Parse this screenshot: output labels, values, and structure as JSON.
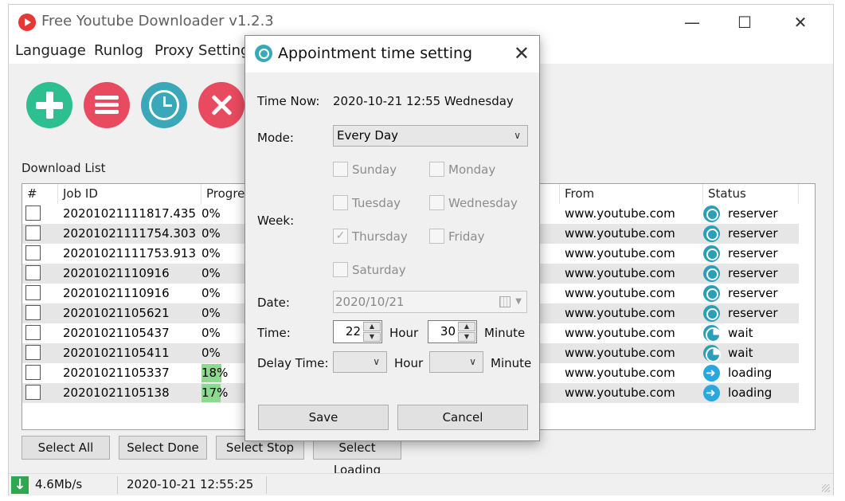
{
  "app": {
    "title": "Free Youtube Downloader v1.2.3",
    "minimize": "—",
    "maximize": "☐",
    "close": "✕"
  },
  "menu": [
    "Language",
    "Runlog",
    "Proxy Setting"
  ],
  "download_list_label": "Download List",
  "table": {
    "columns": [
      "#",
      "Job ID",
      "Progress",
      "From",
      "Status"
    ],
    "rows": [
      {
        "job_id": "20201021111817.435",
        "progress": "0%",
        "progress_value": 0,
        "from": "www.youtube.com",
        "status": "reserver"
      },
      {
        "job_id": "20201021111754.303",
        "progress": "0%",
        "progress_value": 0,
        "from": "www.youtube.com",
        "status": "reserver"
      },
      {
        "job_id": "20201021111753.913",
        "progress": "0%",
        "progress_value": 0,
        "from": "www.youtube.com",
        "status": "reserver"
      },
      {
        "job_id": "20201021110916",
        "progress": "0%",
        "progress_value": 0,
        "from": "www.youtube.com",
        "status": "reserver"
      },
      {
        "job_id": "20201021110916",
        "progress": "0%",
        "progress_value": 0,
        "from": "www.youtube.com",
        "status": "reserver"
      },
      {
        "job_id": "20201021105621",
        "progress": "0%",
        "progress_value": 0,
        "from": "www.youtube.com",
        "status": "reserver"
      },
      {
        "job_id": "20201021105437",
        "progress": "0%",
        "progress_value": 0,
        "from": "www.youtube.com",
        "status": "wait"
      },
      {
        "job_id": "20201021105411",
        "progress": "0%",
        "progress_value": 0,
        "from": "www.youtube.com",
        "status": "wait"
      },
      {
        "job_id": "20201021105337",
        "progress": "18%",
        "progress_value": 18,
        "from": "www.youtube.com",
        "status": "loading"
      },
      {
        "job_id": "20201021105138",
        "progress": "17%",
        "progress_value": 17,
        "from": "www.youtube.com",
        "status": "loading"
      }
    ]
  },
  "buttons": {
    "select_all": "Select All",
    "select_done": "Select Done",
    "select_stop": "Select Stop",
    "select_loading": "Select Loading"
  },
  "statusbar": {
    "speed": "4.6Mb/s",
    "datetime": "2020-10-21 12:55:25"
  },
  "dialog": {
    "title": "Appointment time setting",
    "time_now_label": "Time Now:",
    "time_now_value": "2020-10-21 12:55 Wednesday",
    "mode_label": "Mode:",
    "mode_value": "Every Day",
    "week_label": "Week:",
    "weekdays": [
      {
        "name": "Sunday",
        "checked": false
      },
      {
        "name": "Monday",
        "checked": false
      },
      {
        "name": "Tuesday",
        "checked": false
      },
      {
        "name": "Wednesday",
        "checked": false
      },
      {
        "name": "Thursday",
        "checked": true
      },
      {
        "name": "Friday",
        "checked": false
      },
      {
        "name": "Saturday",
        "checked": false
      }
    ],
    "date_label": "Date:",
    "date_value": "2020/10/21",
    "time_label": "Time:",
    "hour_value": "22",
    "hour_unit": "Hour",
    "minute_value": "30",
    "minute_unit": "Minute",
    "delay_label": "Delay Time:",
    "delay_hour_unit": "Hour",
    "delay_minute_unit": "Minute",
    "save": "Save",
    "cancel": "Cancel"
  },
  "colors": {
    "add": "#2ebf91",
    "list": "#e84a5f",
    "clock": "#3aa8b8",
    "progress_fill": "#8fd88f"
  }
}
